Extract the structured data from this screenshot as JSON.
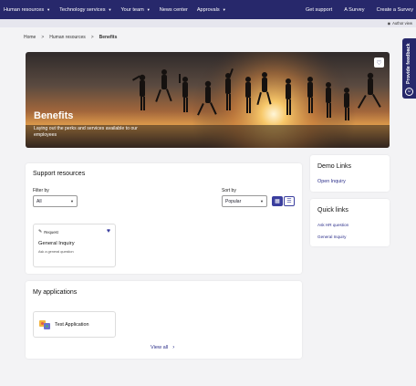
{
  "nav": {
    "items": [
      "Human resources",
      "Technology services",
      "Your team",
      "News center",
      "Approvals"
    ],
    "right_items": [
      "Get support",
      "A Survey",
      "Create a Survey"
    ]
  },
  "subbar": {
    "author_view": "Author view"
  },
  "breadcrumb": {
    "home": "Home",
    "section": "Human resources",
    "current": "Benefits"
  },
  "hero": {
    "title": "Benefits",
    "subtitle": "Laying out the perks and services available to our employees"
  },
  "feedback": {
    "label": "Provide feedback"
  },
  "support": {
    "title": "Support resources",
    "filter_label": "Filter by",
    "filter_value": "All",
    "sort_label": "Sort by",
    "sort_value": "Popular",
    "tile": {
      "type": "Request",
      "name": "General Inquiry",
      "description": "Ask a general question"
    }
  },
  "apps": {
    "title": "My applications",
    "app_name": "Test Application",
    "view_all": "View all"
  },
  "demo": {
    "title": "Demo Links",
    "link": "Open Inquiry"
  },
  "quick": {
    "title": "Quick links",
    "links": [
      "Ask HR question",
      "General Inquiry"
    ]
  },
  "colors": {
    "nav_bg": "#27286b",
    "accent": "#3a3e9e",
    "link": "#2c2f8a"
  },
  "icons": {
    "caret": "chevron-down-icon",
    "favorite": "heart-outline-icon",
    "request": "pencil-icon",
    "heart": "heart-filled-icon",
    "grid_view": "grid-icon",
    "list_view": "list-icon",
    "arrow": "chevron-right-icon"
  }
}
